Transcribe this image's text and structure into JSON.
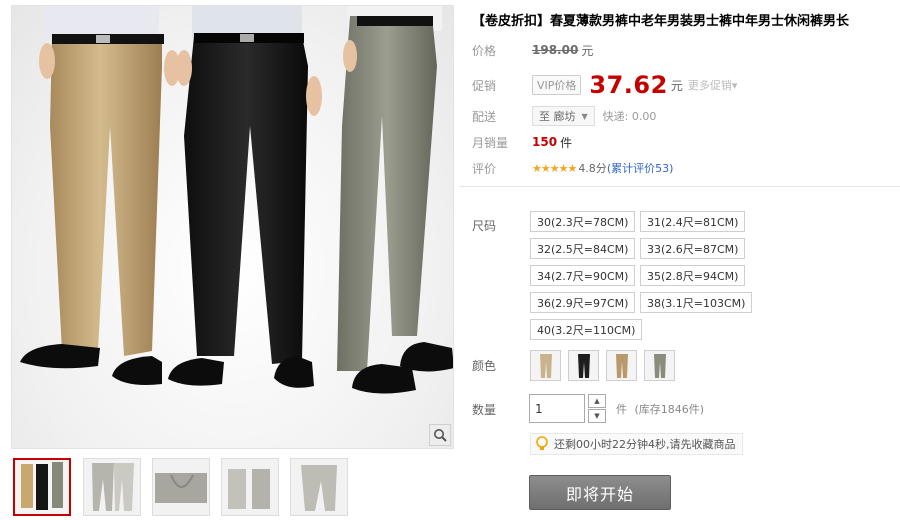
{
  "product": {
    "title": "【卷皮折扣】春夏薄款男裤中老年男装男士裤中年男士休闲裤男长"
  },
  "price_row": {
    "label": "价格",
    "original_price": "198.00",
    "currency": "元"
  },
  "promo_row": {
    "label": "促销",
    "vip_tag": "VIP价格",
    "price": "37.62",
    "currency": "元",
    "more_promo": "更多促销▾"
  },
  "delivery_row": {
    "label": "配送",
    "location": "至 廊坊",
    "shipping": "快递: 0.00"
  },
  "sales_row": {
    "label": "月销量",
    "value": "150",
    "unit": "件"
  },
  "rating_row": {
    "label": "评价",
    "stars": "★★★★★",
    "score": "4.8分",
    "reviews": "(累计评价53)"
  },
  "size": {
    "label": "尺码",
    "options": [
      "30(2.3尺=78CM)",
      "31(2.4尺=81CM)",
      "32(2.5尺=84CM)",
      "33(2.6尺=87CM)",
      "34(2.7尺=90CM)",
      "35(2.8尺=94CM)",
      "36(2.9尺=97CM)",
      "38(3.1尺=103CM)",
      "40(3.2尺=110CM)"
    ]
  },
  "color": {
    "label": "颜色",
    "swatches": [
      "khaki",
      "black",
      "tan",
      "grey"
    ],
    "swatch_colors": [
      "#c9b38c",
      "#1e1e1e",
      "#b89a6c",
      "#8a8c7e"
    ]
  },
  "quantity": {
    "label": "数量",
    "value": "1",
    "unit": "件",
    "stock": "(库存1846件)"
  },
  "timer": {
    "text": "还剩00小时22分钟4秒,请先收藏商品",
    "icon": "lightbulb-icon"
  },
  "buy_button": {
    "label": "即将开始"
  },
  "gallery": {
    "zoom_icon": "magnifier-icon",
    "thumbnails": [
      "trio",
      "grey-front",
      "grey-pocket",
      "grey-legs",
      "grey-side"
    ]
  },
  "colors": {
    "accent": "#c40000",
    "link": "#3366cc",
    "star": "#f5a623",
    "button": "#7a7a7a"
  }
}
